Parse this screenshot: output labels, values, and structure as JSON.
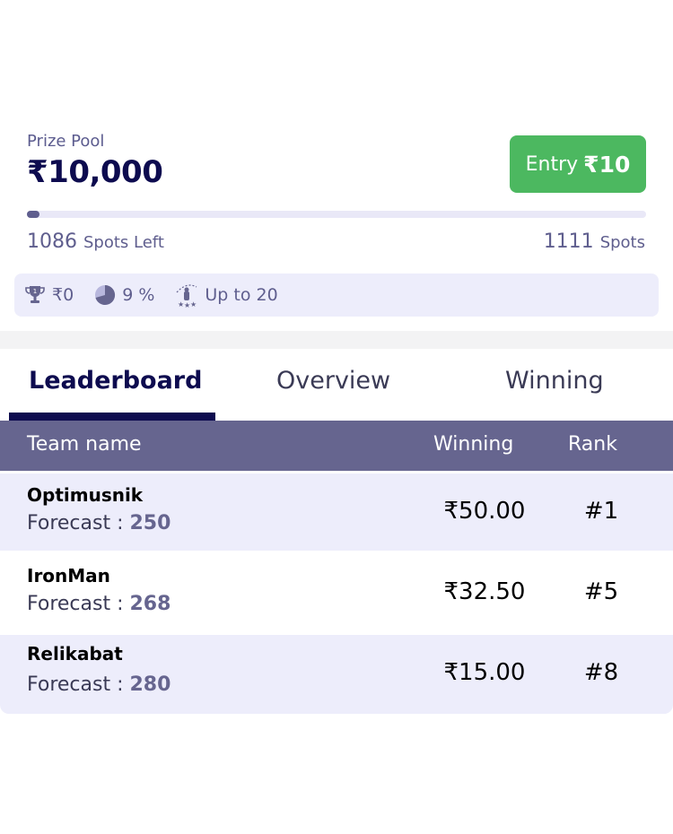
{
  "contest": {
    "prize_label": "Prize Pool",
    "prize_amount": "₹10,000",
    "entry_label": "Entry",
    "entry_amount": "₹10",
    "progress_fraction": 0.02,
    "spots_left_count": "1086",
    "spots_left_label": "Spots Left",
    "spots_total_count": "1111",
    "spots_total_label": "Spots"
  },
  "info": {
    "first_prize": "₹0",
    "win_percent": "9 %",
    "max_entries": "Up to 20"
  },
  "tabs": [
    {
      "label": "Leaderboard",
      "active": true
    },
    {
      "label": "Overview",
      "active": false
    },
    {
      "label": "Winning",
      "active": false
    }
  ],
  "table": {
    "headers": {
      "team": "Team name",
      "winning": "Winning",
      "rank": "Rank"
    },
    "rows": [
      {
        "team": "Optimusnik",
        "forecast_label": "Forecast : ",
        "forecast": "250",
        "winning": "₹50.00",
        "rank": "#1"
      },
      {
        "team": "IronMan",
        "forecast_label": "Forecast : ",
        "forecast": "268",
        "winning": "₹32.50",
        "rank": "#5"
      },
      {
        "team": "Relikabat",
        "forecast_label": "Forecast : ",
        "forecast": "280",
        "winning": "₹15.00",
        "rank": "#8"
      }
    ]
  },
  "colors": {
    "accent_dark": "#0d0b4f",
    "header_purple": "#66658f",
    "entry_green": "#4cb860",
    "row_shade": "#ededfb"
  },
  "icons": [
    "trophy-icon",
    "pie-chart-icon",
    "multi-entry-icon"
  ]
}
